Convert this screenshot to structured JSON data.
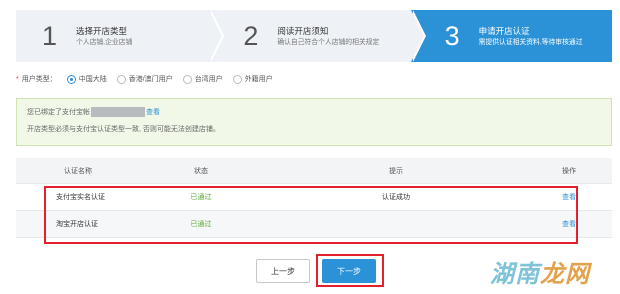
{
  "steps": [
    {
      "num": "1",
      "title": "选择开店类型",
      "sub": "个人店铺,企业店铺",
      "active": false
    },
    {
      "num": "2",
      "title": "阅读开店须知",
      "sub": "确认自己符合个人店铺的相关规定",
      "active": false
    },
    {
      "num": "3",
      "title": "申请开店认证",
      "sub": "需提供认证相关资料,等待审核通过",
      "active": true
    }
  ],
  "user_type": {
    "required_mark": "*",
    "label": "用户类型：",
    "options": [
      {
        "label": "中国大陆",
        "selected": true
      },
      {
        "label": "香港/澳门用户",
        "selected": false
      },
      {
        "label": "台湾用户",
        "selected": false
      },
      {
        "label": "外籍用户",
        "selected": false
      }
    ]
  },
  "notice": {
    "prefix": "您已绑定了支付宝帐",
    "link": "查看",
    "line2": "开店类型必须与支付宝认证类型一致, 否则可能无法创建店铺。"
  },
  "table": {
    "headers": [
      "认证名称",
      "状态",
      "提示",
      "操作"
    ],
    "rows": [
      {
        "name": "支付宝实名认证",
        "status": "已通过",
        "hint": "认证成功",
        "action": "查看"
      },
      {
        "name": "淘宝开店认证",
        "status": "已通过",
        "hint": "",
        "action": "查看"
      }
    ]
  },
  "buttons": {
    "prev": "上一步",
    "next": "下一步"
  },
  "watermark": {
    "part1": "湖南",
    "part2": "龙网"
  },
  "colors": {
    "accent": "#2b92d7",
    "success": "#5cab35",
    "highlight": "#e3202b"
  }
}
